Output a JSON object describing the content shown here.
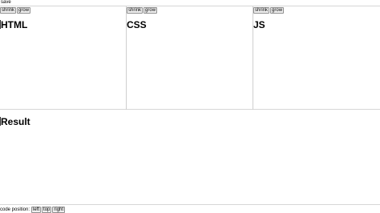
{
  "toolbar": {
    "save_label": "save"
  },
  "panes": [
    {
      "title": "HTML",
      "shrink_label": "shrink",
      "grow_label": "grow"
    },
    {
      "title": "CSS",
      "shrink_label": "shrink",
      "grow_label": "grow"
    },
    {
      "title": "JS",
      "shrink_label": "shrink",
      "grow_label": "grow"
    }
  ],
  "result": {
    "title": "Result"
  },
  "footer": {
    "label": "code position:",
    "options": [
      "left",
      "top",
      "right"
    ]
  }
}
